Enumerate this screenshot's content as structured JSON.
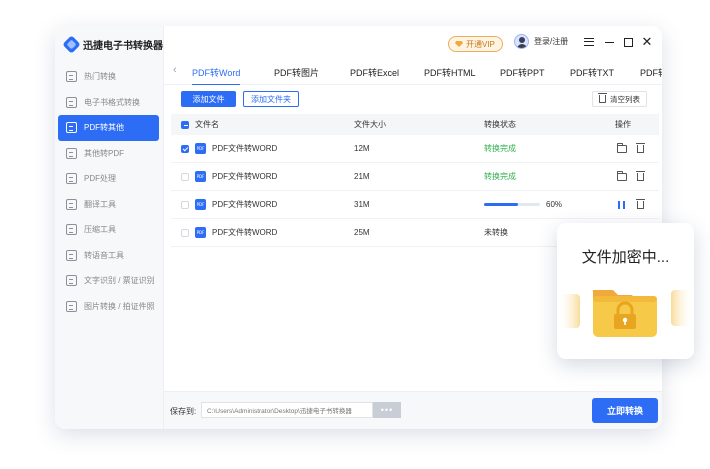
{
  "app": {
    "brand_name": "迅捷电子书转换器"
  },
  "sidebar": {
    "items": [
      {
        "label": "热门转换"
      },
      {
        "label": "电子书格式转换"
      },
      {
        "label": "PDF转其他"
      },
      {
        "label": "其他转PDF"
      },
      {
        "label": "PDF处理"
      },
      {
        "label": "翻译工具"
      },
      {
        "label": "压缩工具"
      },
      {
        "label": "转语音工具"
      },
      {
        "label": "文字识别 / 票证识别"
      },
      {
        "label": "图片转换 / 拍证件照"
      }
    ],
    "active_index": 2
  },
  "topbar": {
    "vip_label": "开通VIP",
    "login_label": "登录/注册"
  },
  "tabs": [
    {
      "label": "PDF转Word"
    },
    {
      "label": "PDF转图片"
    },
    {
      "label": "PDF转Excel"
    },
    {
      "label": "PDF转HTML"
    },
    {
      "label": "PDF转PPT"
    },
    {
      "label": "PDF转TXT"
    },
    {
      "label": "PDF转"
    }
  ],
  "toolbar": {
    "add_file": "添加文件",
    "add_folder": "添加文件夹",
    "clear_list": "清空列表"
  },
  "table": {
    "headers": {
      "name": "文件名",
      "size": "文件大小",
      "status": "转换状态",
      "action": "操作"
    },
    "rows": [
      {
        "name": "PDF文件转WORD",
        "size": "12M",
        "status": "转换完成",
        "checked": true
      },
      {
        "name": "PDF文件转WORD",
        "size": "21M",
        "status": "转换完成",
        "checked": false
      },
      {
        "name": "PDF文件转WORD",
        "size": "31M",
        "status": "",
        "progress_pct": "60%",
        "progress": 0.6,
        "checked": false
      },
      {
        "name": "PDF文件转WORD",
        "size": "25M",
        "status": "未转换",
        "checked": false
      }
    ]
  },
  "bottom": {
    "save_label": "保存到:",
    "save_path": "C:\\Users\\Administrator\\Desktop\\迅捷电子书转换器",
    "more_label": "•••",
    "convert_label": "立即转换"
  },
  "overlay": {
    "title": "文件加密中..."
  },
  "colors": {
    "accent": "#2d6df6",
    "success": "#2fb24c",
    "vip": "#f0a93b",
    "folder": "#f7c948"
  }
}
